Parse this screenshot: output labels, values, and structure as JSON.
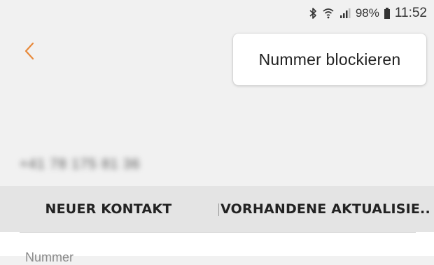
{
  "status_bar": {
    "icons": [
      "bluetooth-icon",
      "wifi-icon",
      "signal-icon",
      "battery-icon"
    ],
    "battery": "98%",
    "time": "11:52"
  },
  "back": {
    "icon": "chevron-left-icon",
    "color": "#e8893a"
  },
  "menu": {
    "items": [
      {
        "label": "Nummer blockieren"
      }
    ]
  },
  "contact": {
    "number": "+41 78 175 81 36"
  },
  "actions": {
    "new_contact": "NEUER KONTAKT",
    "update_existing": "VORHANDENE AKTUALISIE.."
  },
  "details": {
    "number_label": "Nummer"
  }
}
